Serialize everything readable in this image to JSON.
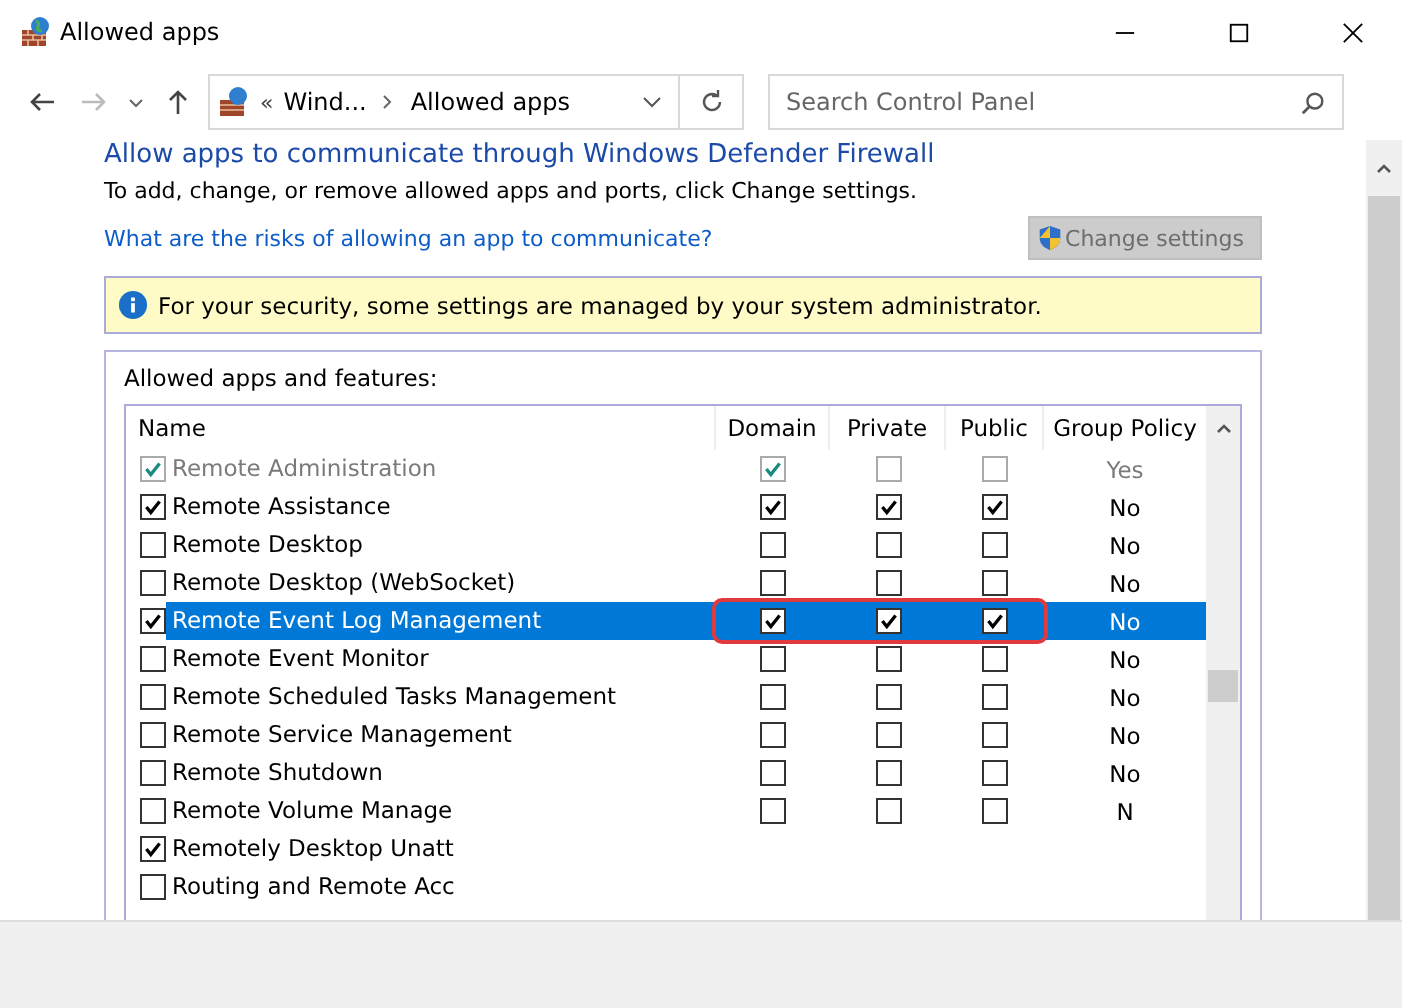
{
  "window": {
    "title": "Allowed apps"
  },
  "address_bar": {
    "overflow": "«",
    "crumbs": [
      "Wind...",
      "Allowed apps"
    ]
  },
  "search": {
    "placeholder": "Search Control Panel"
  },
  "heading": "Allow apps to communicate through Windows Defender Firewall",
  "description": "To add, change, or remove allowed apps and ports, click Change settings.",
  "help_link": "What are the risks of allowing an app to communicate?",
  "change_settings_button": {
    "label": "Change settings",
    "disabled": true
  },
  "info_banner": "For your security, some settings are managed by your system administrator.",
  "group_label": "Allowed apps and features:",
  "table": {
    "columns": [
      "Name",
      "Domain",
      "Private",
      "Public",
      "Group Policy"
    ],
    "rows": [
      {
        "name": "Remote Administration",
        "checked": true,
        "domain": true,
        "private": false,
        "public": false,
        "group_policy": "Yes",
        "disabled": true,
        "selected": false,
        "highlighted": false
      },
      {
        "name": "Remote Assistance",
        "checked": true,
        "domain": true,
        "private": true,
        "public": true,
        "group_policy": "No",
        "disabled": false,
        "selected": false,
        "highlighted": false
      },
      {
        "name": "Remote Desktop",
        "checked": false,
        "domain": false,
        "private": false,
        "public": false,
        "group_policy": "No",
        "disabled": false,
        "selected": false,
        "highlighted": false
      },
      {
        "name": "Remote Desktop (WebSocket)",
        "checked": false,
        "domain": false,
        "private": false,
        "public": false,
        "group_policy": "No",
        "disabled": false,
        "selected": false,
        "highlighted": false
      },
      {
        "name": "Remote Event Log Management",
        "checked": true,
        "domain": true,
        "private": true,
        "public": true,
        "group_policy": "No",
        "disabled": false,
        "selected": true,
        "highlighted": true
      },
      {
        "name": "Remote Event Monitor",
        "checked": false,
        "domain": false,
        "private": false,
        "public": false,
        "group_policy": "No",
        "disabled": false,
        "selected": false,
        "highlighted": false
      },
      {
        "name": "Remote Scheduled Tasks Management",
        "checked": false,
        "domain": false,
        "private": false,
        "public": false,
        "group_policy": "No",
        "disabled": false,
        "selected": false,
        "highlighted": false
      },
      {
        "name": "Remote Service Management",
        "checked": false,
        "domain": false,
        "private": false,
        "public": false,
        "group_policy": "No",
        "disabled": false,
        "selected": false,
        "highlighted": false
      },
      {
        "name": "Remote Shutdown",
        "checked": false,
        "domain": false,
        "private": false,
        "public": false,
        "group_policy": "No",
        "disabled": false,
        "selected": false,
        "highlighted": false
      },
      {
        "name": "Remote Volume Manage",
        "checked": false,
        "domain": false,
        "private": false,
        "public": false,
        "group_policy": "N",
        "disabled": false,
        "selected": false,
        "highlighted": false
      },
      {
        "name": "Remotely Desktop Unatt",
        "checked": true,
        "disabled": false,
        "selected": false,
        "highlighted": false
      },
      {
        "name": "Routing and Remote Acc",
        "checked": false,
        "disabled": false,
        "selected": false,
        "highlighted": false
      }
    ]
  }
}
